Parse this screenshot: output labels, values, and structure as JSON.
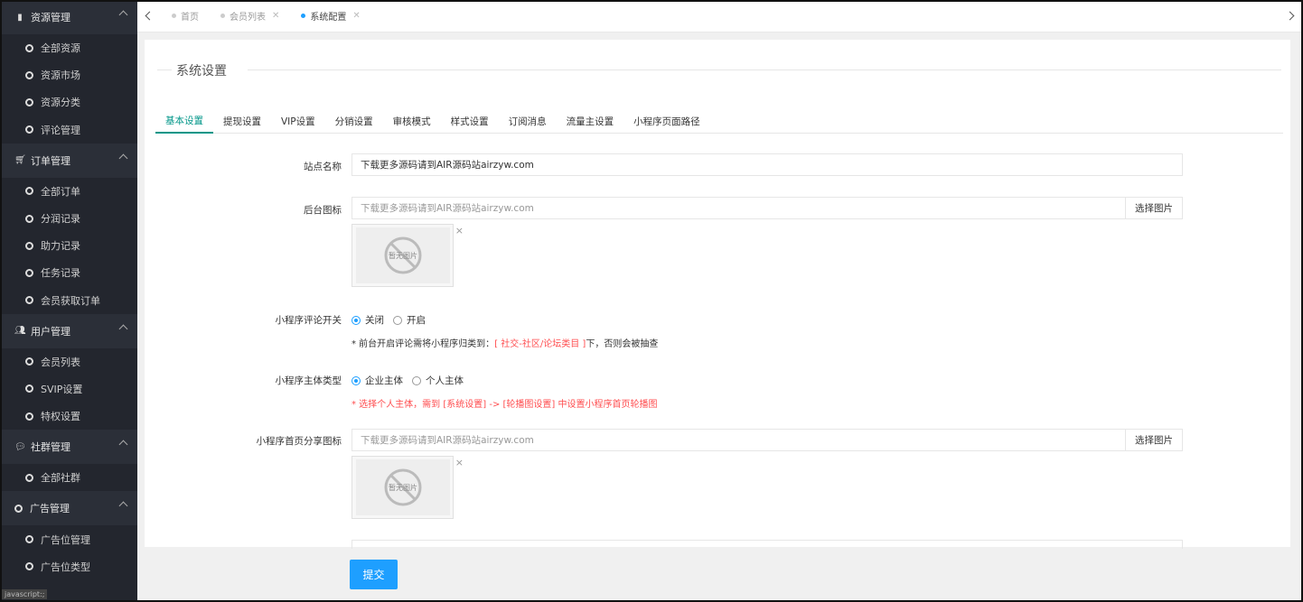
{
  "sidebar": {
    "groups": [
      {
        "title": "资源管理",
        "icon": "book-icon",
        "items": [
          "全部资源",
          "资源市场",
          "资源分类",
          "评论管理"
        ]
      },
      {
        "title": "订单管理",
        "icon": "cart-icon",
        "items": [
          "全部订单",
          "分润记录",
          "助力记录",
          "任务记录",
          "会员获取订单"
        ]
      },
      {
        "title": "用户管理",
        "icon": "users-icon",
        "items": [
          "会员列表",
          "SVIP设置",
          "特权设置"
        ]
      },
      {
        "title": "社群管理",
        "icon": "chat-icon",
        "items": [
          "全部社群"
        ]
      },
      {
        "title": "广告管理",
        "icon": "circle-icon",
        "items": [
          "广告位管理",
          "广告位类型"
        ]
      }
    ],
    "tooltip": "javascript:;"
  },
  "tabs": [
    {
      "label": "首页",
      "closable": false,
      "active": false
    },
    {
      "label": "会员列表",
      "closable": true,
      "active": false
    },
    {
      "label": "系统配置",
      "closable": true,
      "active": true
    }
  ],
  "page": {
    "title": "系统设置",
    "subtabs": [
      "基本设置",
      "提现设置",
      "VIP设置",
      "分销设置",
      "审核模式",
      "样式设置",
      "订阅消息",
      "流量主设置",
      "小程序页面路径"
    ]
  },
  "form": {
    "site_name": {
      "label": "站点名称",
      "value": "下载更多源码请到AIR源码站airzyw.com"
    },
    "admin_icon": {
      "label": "后台图标",
      "placeholder": "下载更多源码请到AIR源码站airzyw.com",
      "button": "选择图片",
      "empty_text": "暂无图片",
      "remove": "×"
    },
    "comment_switch": {
      "label": "小程序评论开关",
      "options": [
        "关闭",
        "开启"
      ],
      "selected": "关闭",
      "hint_prefix": "* 前台开启评论需将小程序归类到：",
      "hint_highlight": "[ 社交-社区/论坛类目 ]",
      "hint_suffix": "下，否则会被抽查"
    },
    "subject_type": {
      "label": "小程序主体类型",
      "options": [
        "企业主体",
        "个人主体"
      ],
      "selected": "企业主体",
      "hint": "* 选择个人主体，需到 [系统设置] -> [轮播图设置] 中设置小程序首页轮播图"
    },
    "share_icon": {
      "label": "小程序首页分享图标",
      "placeholder": "下载更多源码请到AIR源码站airzyw.com",
      "button": "选择图片",
      "empty_text": "暂无图片",
      "remove": "×"
    },
    "submit": "提交"
  },
  "colors": {
    "sidebar_bg": "#23262e",
    "accent_teal": "#009688",
    "primary_blue": "#1e9fff",
    "warning_red": "#ff4d4f"
  }
}
